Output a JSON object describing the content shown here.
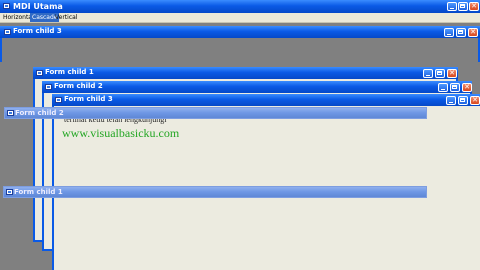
{
  "app": {
    "title": "MDI Utama"
  },
  "menu": {
    "items": [
      "Horizontal",
      "Cascade",
      "Vertical"
    ],
    "selected": "Cascade"
  },
  "windows": {
    "top_fc3": {
      "title": "Form child 3"
    },
    "cascade_fc1": {
      "title": "Form child 1"
    },
    "cascade_fc2": {
      "title": "Form child 2"
    },
    "cascade_fc3": {
      "title": "Form child 3"
    },
    "strip_fc2": {
      "title": "Form child 2"
    },
    "strip_fc1": {
      "title": "Form child 1"
    }
  },
  "content": {
    "partial_text": "terlihat ketiu telah lengkunjungi",
    "website": "www.visualbasicku.com"
  },
  "colors": {
    "titlebar": "#0a5ae6",
    "client": "#ecebe0",
    "link_green": "#24a624",
    "close": "#d8481e"
  },
  "icons": {
    "window": "window-icon",
    "minimize": "minimize-icon",
    "maximize": "maximize-icon",
    "close": "close-icon"
  }
}
